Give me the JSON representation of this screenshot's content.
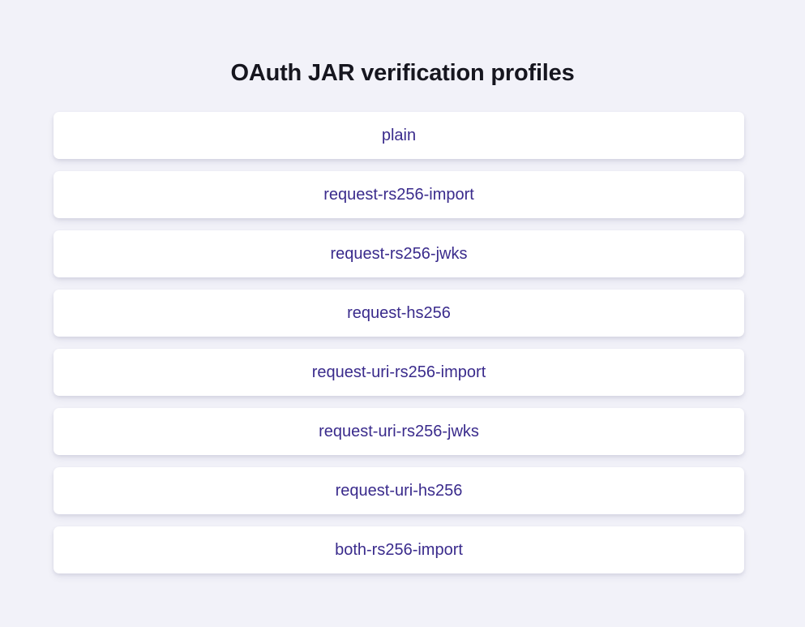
{
  "page": {
    "title": "OAuth JAR verification profiles"
  },
  "profiles": [
    {
      "label": "plain"
    },
    {
      "label": "request-rs256-import"
    },
    {
      "label": "request-rs256-jwks"
    },
    {
      "label": "request-hs256"
    },
    {
      "label": "request-uri-rs256-import"
    },
    {
      "label": "request-uri-rs256-jwks"
    },
    {
      "label": "request-uri-hs256"
    },
    {
      "label": "both-rs256-import"
    }
  ],
  "colors": {
    "background": "#f2f2f9",
    "card": "#ffffff",
    "title_text": "#16161f",
    "link_text": "#3a2b8c"
  }
}
